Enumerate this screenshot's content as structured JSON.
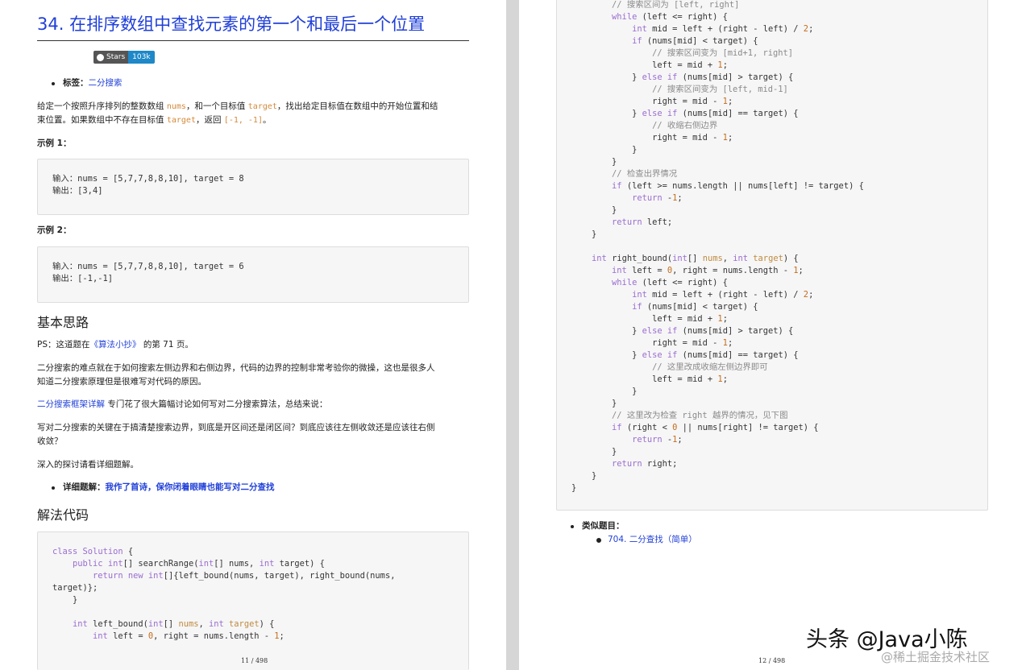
{
  "page1": {
    "title": "34. 在排序数组中查找元素的第一个和最后一个位置",
    "badge": {
      "label": "Stars",
      "count": "103k"
    },
    "tags_label": "标签：",
    "tags_value": "二分搜索",
    "desc_line1_a": "给定一个按照升序排列的整数数组 ",
    "desc_code1": "nums",
    "desc_line1_b": "，和一个目标值 ",
    "desc_code2": "target",
    "desc_line1_c": "，找出给定目标值在数组中的开始位置和结",
    "desc_line2_a": "束位置。如果数组中不存在目标值 ",
    "desc_code3": "target",
    "desc_line2_b": "，返回 ",
    "desc_code4": "[-1, -1]",
    "desc_line2_c": "。",
    "example1_label": "示例 1：",
    "example1_code": "输入：nums = [5,7,7,8,8,10], target = 8\n输出：[3,4]",
    "example2_label": "示例 2：",
    "example2_code": "输入：nums = [5,7,7,8,8,10], target = 6\n输出：[-1,-1]",
    "section1": "基本思路",
    "ps_a": "PS：这道题在",
    "ps_link": "《算法小抄》",
    "ps_b": " 的第 71 页。",
    "para1_l1": "二分搜索的难点就在于如何搜索左侧边界和右侧边界，代码的边界的控制非常考验你的微操，这也是很多人",
    "para1_l2": "知道二分搜索原理但是很难写对代码的原因。",
    "para2_link": "二分搜索框架详解",
    "para2_rest": " 专门花了很大篇幅讨论如何写对二分搜索算法，总结来说：",
    "para3_l1": "写对二分搜索的关键在于搞清楚搜索边界，到底是开区间还是闭区间？到底应该往左侧收敛还是应该往右侧",
    "para3_l2": "收敛？",
    "para4": "深入的探讨请看详细题解。",
    "detail_label": "详细题解：",
    "detail_link": "我作了首诗，保你闭着眼睛也能写对二分查找",
    "section2": "解法代码",
    "page_num": "11 / 498"
  },
  "page2": {
    "similar_label": "类似题目：",
    "similar_link": "704. 二分查找（简单）",
    "page_num": "12 / 498"
  },
  "watermark": {
    "main": "头条 @Java小陈",
    "sub": "@稀土掘金技术社区"
  }
}
